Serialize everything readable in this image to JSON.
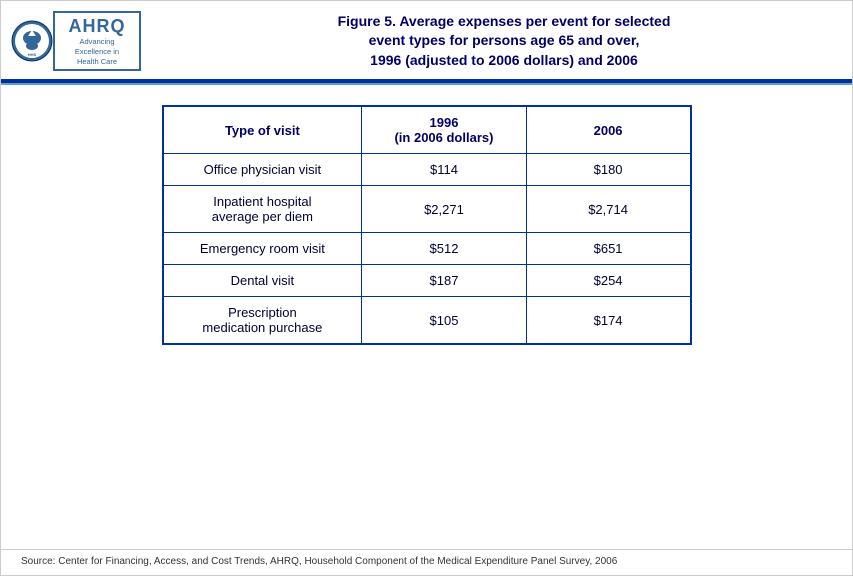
{
  "header": {
    "ahrq_text": "AHRQ",
    "ahrq_subtitle_line1": "Advancing",
    "ahrq_subtitle_line2": "Excellence in",
    "ahrq_subtitle_line3": "Health Care",
    "title_line1": "Figure 5. Average expenses per event for selected",
    "title_line2": "event types for persons age 65 and over,",
    "title_line3": "1996 (adjusted to 2006 dollars) and 2006"
  },
  "table": {
    "col_headers": [
      "Type of visit",
      "1996\n(in 2006 dollars)",
      "2006"
    ],
    "col1_header": "Type of visit",
    "col2_header_line1": "1996",
    "col2_header_line2": "(in 2006 dollars)",
    "col3_header": "2006",
    "rows": [
      {
        "visit": "Office physician visit",
        "val1996": "$114",
        "val2006": "$180"
      },
      {
        "visit_line1": "Inpatient hospital",
        "visit_line2": "average per diem",
        "val1996": "$2,271",
        "val2006": "$2,714"
      },
      {
        "visit": "Emergency room visit",
        "val1996": "$512",
        "val2006": "$651"
      },
      {
        "visit": "Dental visit",
        "val1996": "$187",
        "val2006": "$254"
      },
      {
        "visit_line1": "Prescription",
        "visit_line2": "medication purchase",
        "val1996": "$105",
        "val2006": "$174"
      }
    ]
  },
  "footer": {
    "source_text": "Source: Center for Financing, Access, and Cost Trends, AHRQ, Household Component of the Medical Expenditure Panel Survey, 2006"
  }
}
